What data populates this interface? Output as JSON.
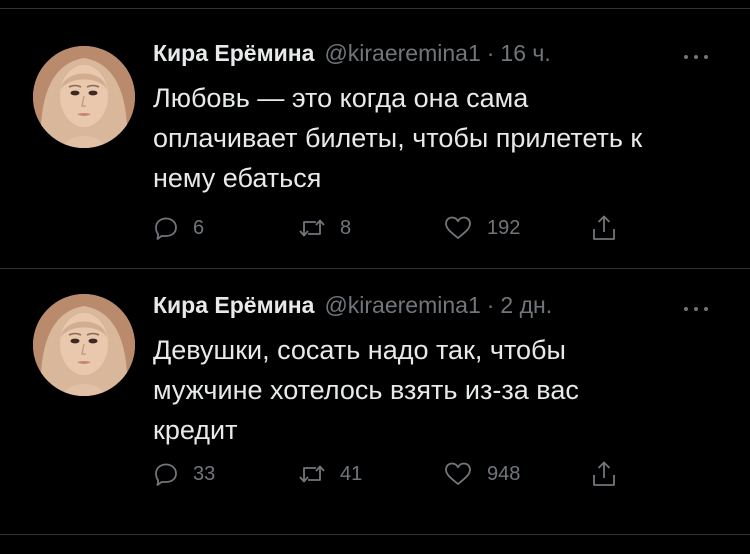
{
  "colors": {
    "background": "#000000",
    "text_primary": "#e7e9ea",
    "text_secondary": "#71767b",
    "divider": "#2f3336"
  },
  "tweets": [
    {
      "author_name": "Кира Ерёмина",
      "handle": "@kiraeremina1",
      "separator": "·",
      "time": "16 ч.",
      "text_lines": [
        "Любовь — это когда она сама",
        "оплачивает билеты, чтобы прилететь к",
        "нему ебаться"
      ],
      "replies": "6",
      "retweets": "8",
      "likes": "192",
      "icons": [
        "reply-icon",
        "retweet-icon",
        "like-icon",
        "share-icon",
        "more-icon"
      ]
    },
    {
      "author_name": "Кира Ерёмина",
      "handle": "@kiraeremina1",
      "separator": "·",
      "time": "2 дн.",
      "text_lines": [
        "Девушки, сосать надо так, чтобы",
        "мужчине хотелось взять из-за вас",
        "кредит"
      ],
      "replies": "33",
      "retweets": "41",
      "likes": "948",
      "icons": [
        "reply-icon",
        "retweet-icon",
        "like-icon",
        "share-icon",
        "more-icon"
      ]
    }
  ]
}
